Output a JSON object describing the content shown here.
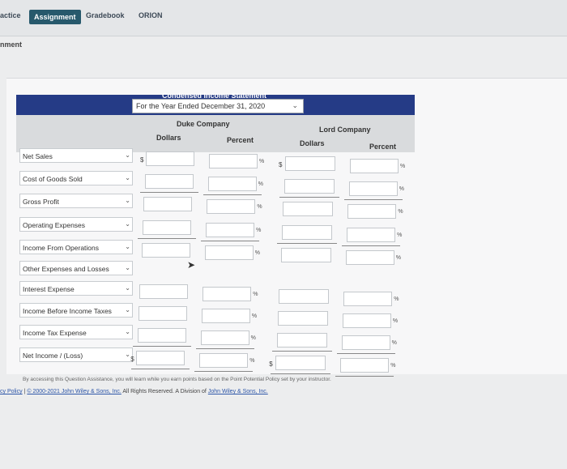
{
  "nav": {
    "tabs": [
      "actice",
      "Assignment",
      "Gradebook",
      "ORION"
    ],
    "active": "Assignment"
  },
  "page_heading": "nment",
  "statement": {
    "title": "Condensed Income Statement",
    "period": "For the Year Ended December 31, 2020",
    "companies": [
      "Duke Company",
      "Lord Company"
    ],
    "col_dollars": "Dollars",
    "col_percent": "Percent",
    "dollar_sign": "$",
    "percent_sign": "%",
    "rows": [
      "Net Sales",
      "Cost of Goods Sold",
      "Gross Profit",
      "Operating Expenses",
      "Income From Operations",
      "Other Expenses and Losses",
      "Interest Expense",
      "Income Before Income Taxes",
      "Income Tax Expense",
      "Net Income / (Loss)"
    ]
  },
  "footer": {
    "notice": "By accessing this Question Assistance, you will learn while you earn points based on the Point Potential Policy set by your instructor.",
    "policy_link": "cy Policy",
    "separator": "|",
    "copyright_link": "© 2000-2021 John Wiley & Sons, Inc.",
    "rights": "All Rights Reserved. A Division of",
    "division_link": "John Wiley & Sons, Inc."
  },
  "colors": {
    "header_band": "#253b86",
    "active_tab": "#27596c"
  }
}
